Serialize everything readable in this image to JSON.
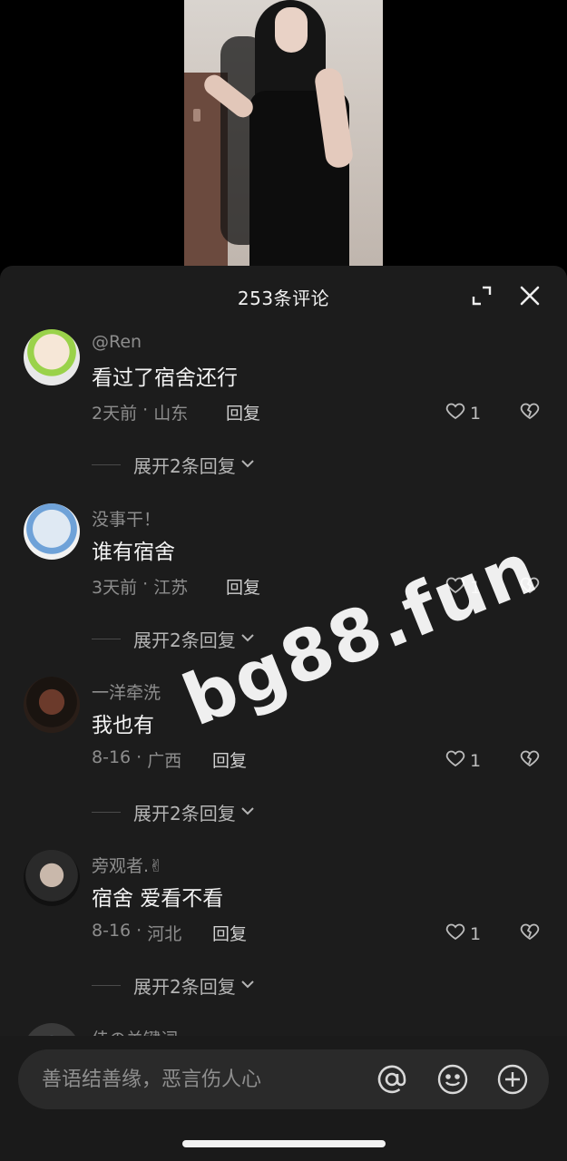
{
  "header": {
    "title": "253条评论"
  },
  "comments": [
    {
      "username": "@Ren",
      "text": "看过了宿舍还行",
      "time": "2天前",
      "location": "山东",
      "reply_label": "回复",
      "likes": "1",
      "expand_label": "展开2条回复"
    },
    {
      "username": "没事干！",
      "text": "谁有宿舍",
      "time": "3天前",
      "location": "江苏",
      "reply_label": "回复",
      "likes": "1",
      "expand_label": "展开2条回复"
    },
    {
      "username": "一洋牵洗",
      "text": "我也有",
      "time": "8-16",
      "location": "广西",
      "reply_label": "回复",
      "likes": "1",
      "expand_label": "展开2条回复"
    },
    {
      "username": "旁观者.✌",
      "text": "宿舍 爱看不看",
      "time": "8-16",
      "location": "河北",
      "reply_label": "回复",
      "likes": "1",
      "expand_label": "展开2条回复"
    },
    {
      "username": "佳の关键词"
    }
  ],
  "watermark": "bg88.fun",
  "input": {
    "placeholder": "善语结善缘，恶言伤人心"
  },
  "icons": {
    "at": "at-icon",
    "emoji": "emoji-icon",
    "plus": "plus-icon"
  },
  "colors": {
    "sheet_bg": "#1c1c1c",
    "text": "#f2f2f2",
    "muted": "#8d8d8d"
  }
}
